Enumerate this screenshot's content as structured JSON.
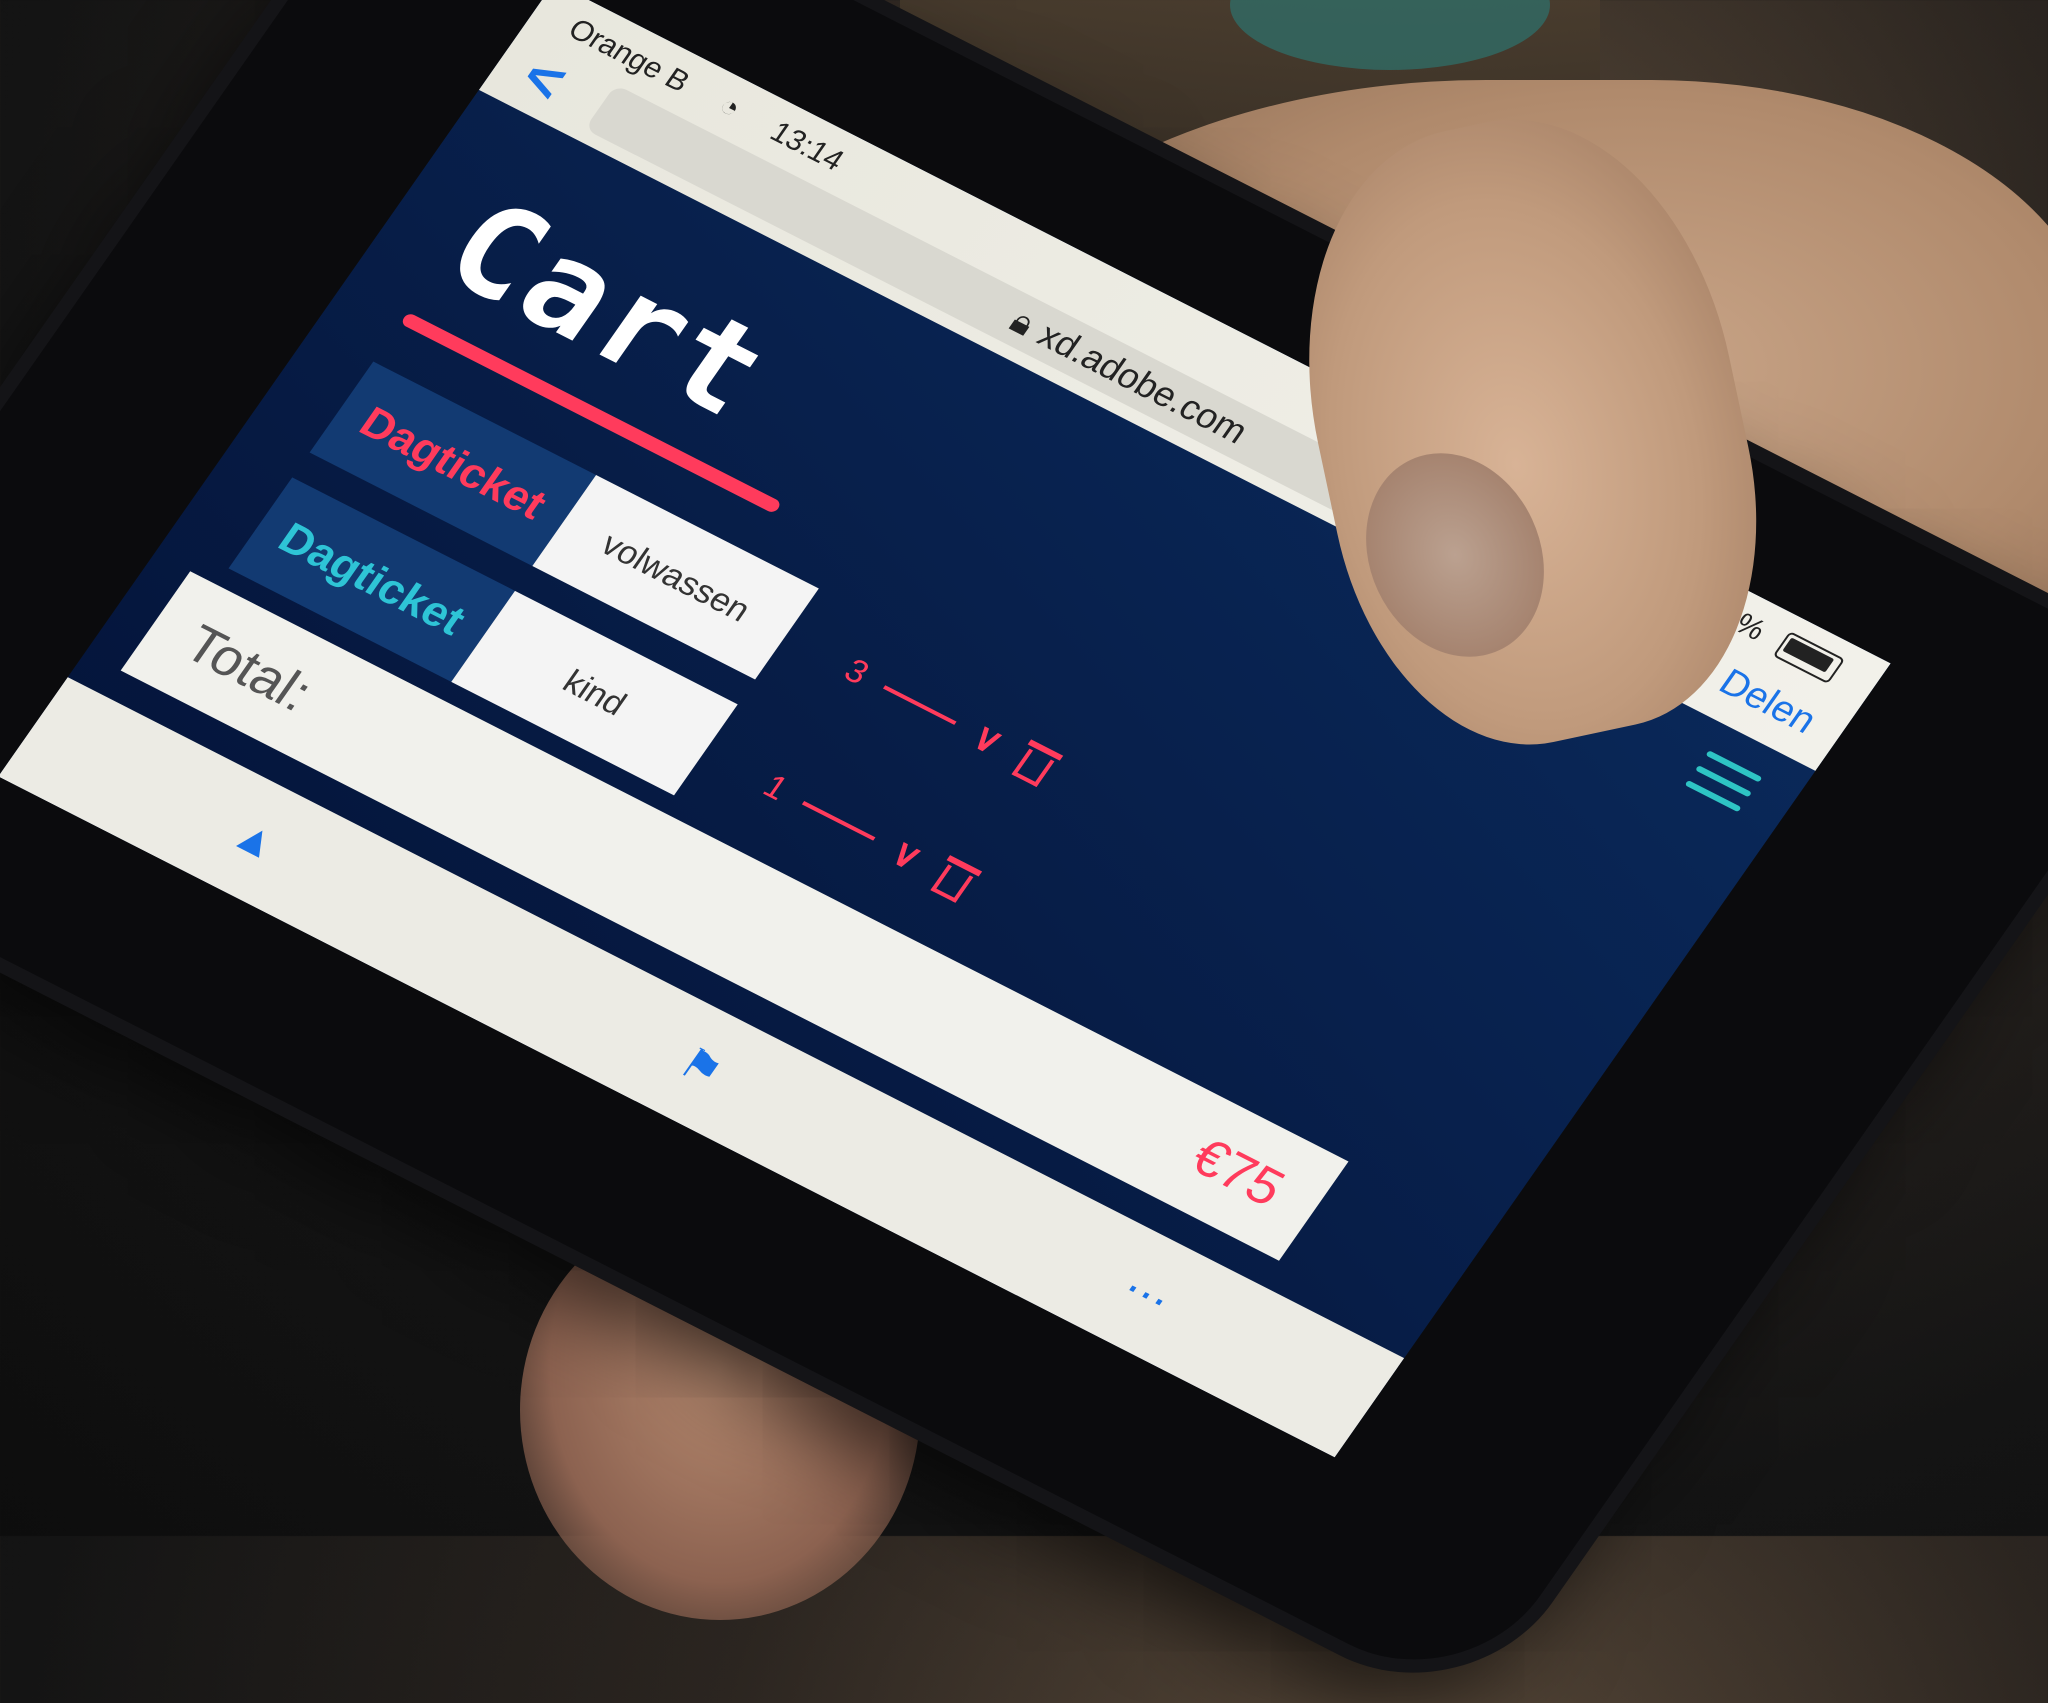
{
  "status_bar": {
    "carrier": "Orange B",
    "time": "13:14",
    "battery": "92%"
  },
  "browser": {
    "back_label": "<",
    "url": "xd.adobe.com",
    "share_label": "Delen"
  },
  "page": {
    "title": "Cart",
    "items": [
      {
        "type": "Dagticket",
        "variant": "volwassen",
        "quantity": "3",
        "type_color": "#ff3b5c"
      },
      {
        "type": "Dagticket",
        "variant": "kind",
        "quantity": "1",
        "type_color": "#2ec4d6"
      }
    ],
    "total_label": "Total:",
    "total_value": "€75"
  },
  "toolbar": {
    "icons": [
      "share-icon",
      "bookmarks-icon",
      "more-icon"
    ]
  },
  "colors": {
    "accent": "#ff3b5c",
    "background": "#071d47",
    "menu": "#2ec4c4",
    "link": "#1a73e8"
  }
}
